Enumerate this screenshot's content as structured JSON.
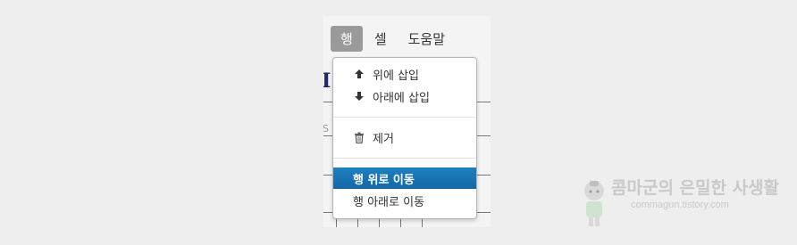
{
  "menubar": {
    "tabs": [
      {
        "label": "행",
        "active": true
      },
      {
        "label": "셀",
        "active": false
      },
      {
        "label": "도움말",
        "active": false
      }
    ]
  },
  "dropdown": {
    "items": [
      {
        "label": "위에 삽입",
        "icon": "arrow-up-icon"
      },
      {
        "label": "아래에 삽입",
        "icon": "arrow-down-icon"
      },
      {
        "label": "제거",
        "icon": "trash-icon"
      },
      {
        "label": "행 위로 이동",
        "highlighted": true
      },
      {
        "label": "행 아래로 이동"
      }
    ]
  },
  "background": {
    "glyph": "I",
    "side_text": "S"
  },
  "watermark": {
    "title": "콤마군의 은밀한 사생활",
    "url": "commagun.tistory.com"
  },
  "colors": {
    "active_tab": "#9a9a9a",
    "highlight": "#1a74b3"
  }
}
